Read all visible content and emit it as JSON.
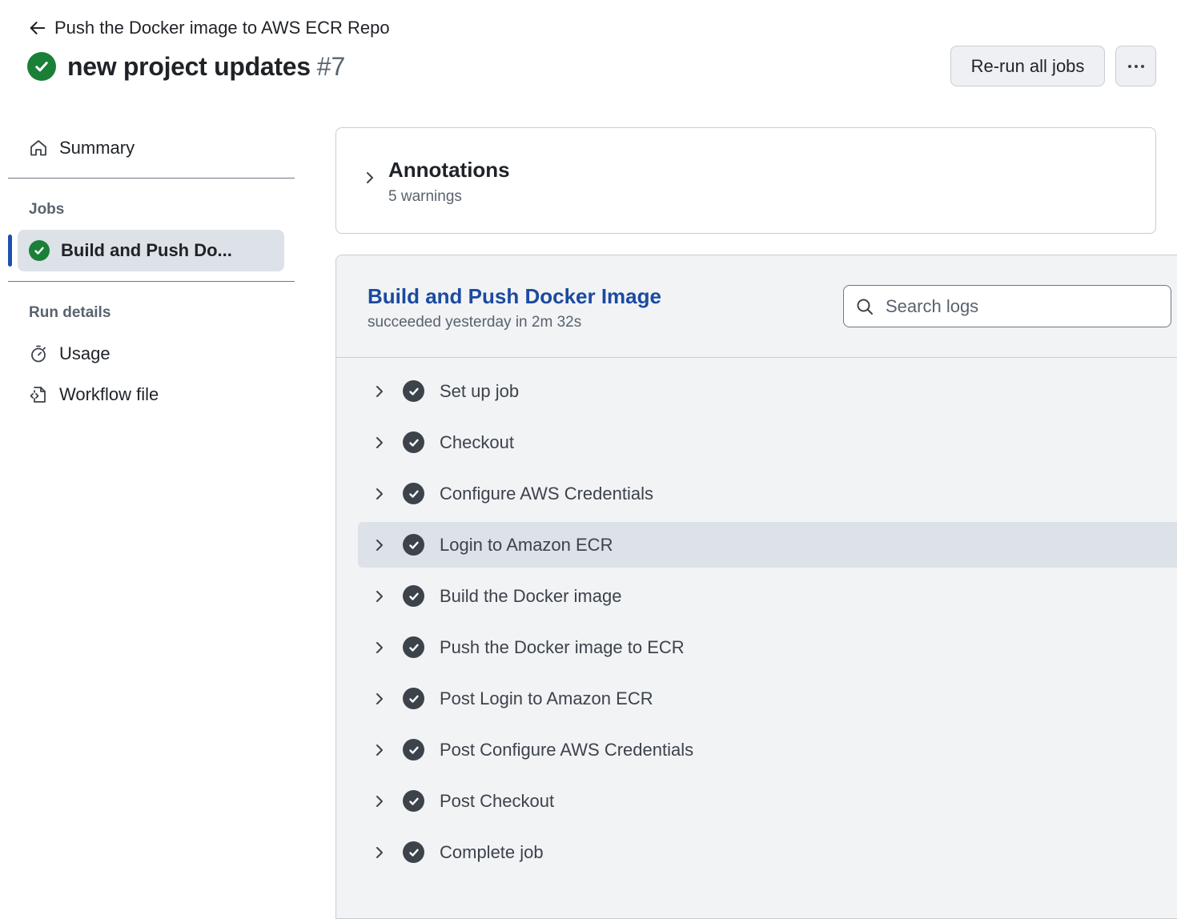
{
  "header": {
    "back_label": "Push the Docker image to AWS ECR Repo",
    "run_title": "new project updates",
    "run_number": "#7",
    "rerun_label": "Re-run all jobs"
  },
  "sidebar": {
    "summary_label": "Summary",
    "jobs_heading": "Jobs",
    "job_name": "Build and Push Do...",
    "run_details_heading": "Run details",
    "usage_label": "Usage",
    "workflow_file_label": "Workflow file"
  },
  "annotations": {
    "title": "Annotations",
    "subtitle": "5 warnings"
  },
  "job": {
    "title": "Build and Push Docker Image",
    "status": "succeeded yesterday in 2m 32s",
    "search_placeholder": "Search logs",
    "steps": [
      {
        "label": "Set up job"
      },
      {
        "label": "Checkout"
      },
      {
        "label": "Configure AWS Credentials"
      },
      {
        "label": "Login to Amazon ECR"
      },
      {
        "label": "Build the Docker image"
      },
      {
        "label": "Push the Docker image to ECR"
      },
      {
        "label": "Post Login to Amazon ECR"
      },
      {
        "label": "Post Configure AWS Credentials"
      },
      {
        "label": "Post Checkout"
      },
      {
        "label": "Complete job"
      }
    ],
    "highlighted_step": "Login to Amazon ECR"
  },
  "colors": {
    "success": "#1a7f37",
    "link": "#1b4aa0",
    "step_check": "#3d434b",
    "selected_bg": "#dde1e8"
  }
}
